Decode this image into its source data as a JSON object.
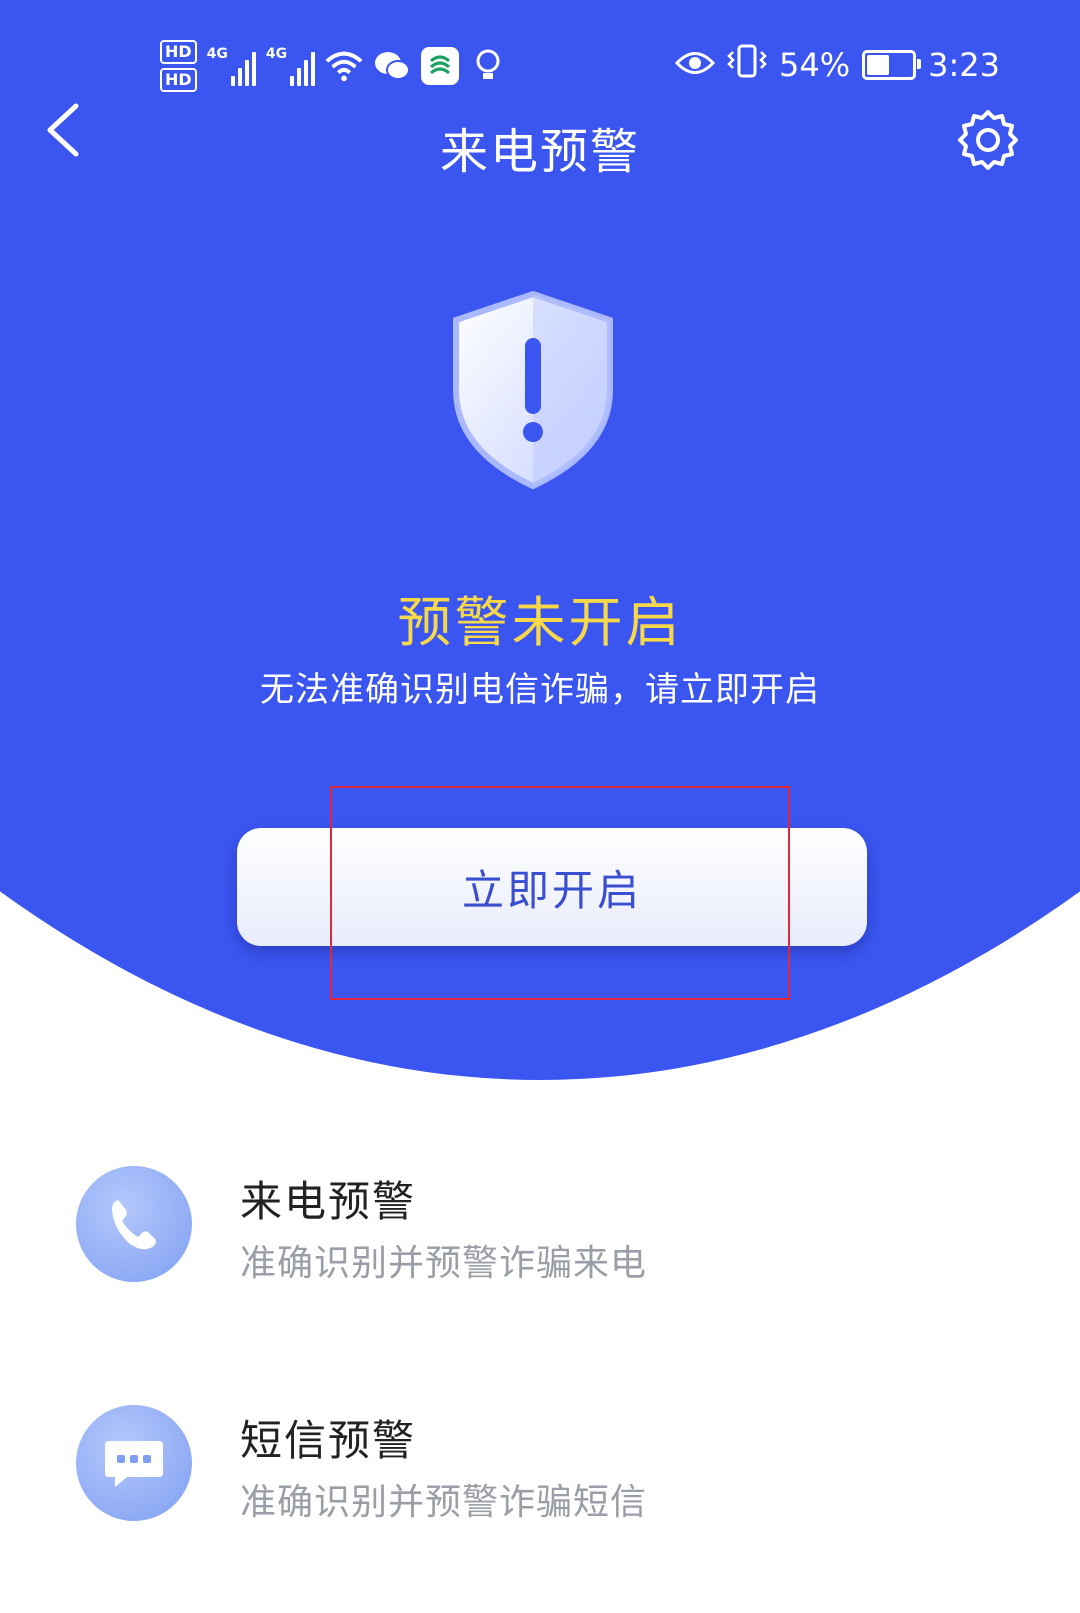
{
  "status_bar": {
    "hd1": "HD",
    "hd2": "HD",
    "sim1_net": "4G",
    "sim2_net": "4G",
    "battery": "54%",
    "battery_level": 0.54,
    "time": "3:23",
    "icons": [
      "signal-icon",
      "wifi-icon",
      "wechat-icon",
      "app-icon",
      "bulb-icon",
      "eye-icon",
      "vibrate-icon",
      "battery-icon"
    ]
  },
  "nav": {
    "title": "来电预警",
    "back_icon": "chevron-left-icon",
    "settings_icon": "gear-icon"
  },
  "hero": {
    "status_title": "预警未开启",
    "status_desc": "无法准确识别电信诈骗，请立即开启",
    "enable_label": "立即开启",
    "shield_icon": "shield-warning-icon"
  },
  "features": [
    {
      "title": "来电预警",
      "subtitle": "准确识别并预警诈骗来电",
      "icon": "phone-icon"
    },
    {
      "title": "短信预警",
      "subtitle": "准确识别并预警诈骗短信",
      "icon": "message-icon"
    }
  ],
  "colors": {
    "primary_blue": "#3a55f0",
    "warning_yellow": "#f6d84a",
    "highlight_red": "#e2283a"
  }
}
